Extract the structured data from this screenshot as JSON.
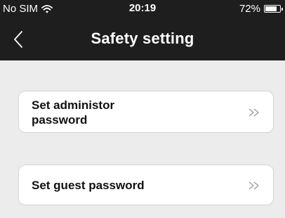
{
  "status_bar": {
    "carrier": "No SIM",
    "time": "20:19",
    "battery_text": "72%",
    "battery_level": 0.72,
    "icons": [
      "wifi-icon",
      "battery-icon"
    ]
  },
  "nav": {
    "title": "Safety setting",
    "back_icon": "chevron-left-icon"
  },
  "items": [
    {
      "label": "Set administor password",
      "icon": "double-chevron-right-icon"
    },
    {
      "label": "Set guest password",
      "icon": "double-chevron-right-icon"
    }
  ],
  "colors": {
    "bar_background": "#1e1e1e",
    "content_background": "#ececec",
    "card_background": "#ffffff",
    "card_border": "#d4d4d4",
    "chevron": "#9a9a9a"
  }
}
